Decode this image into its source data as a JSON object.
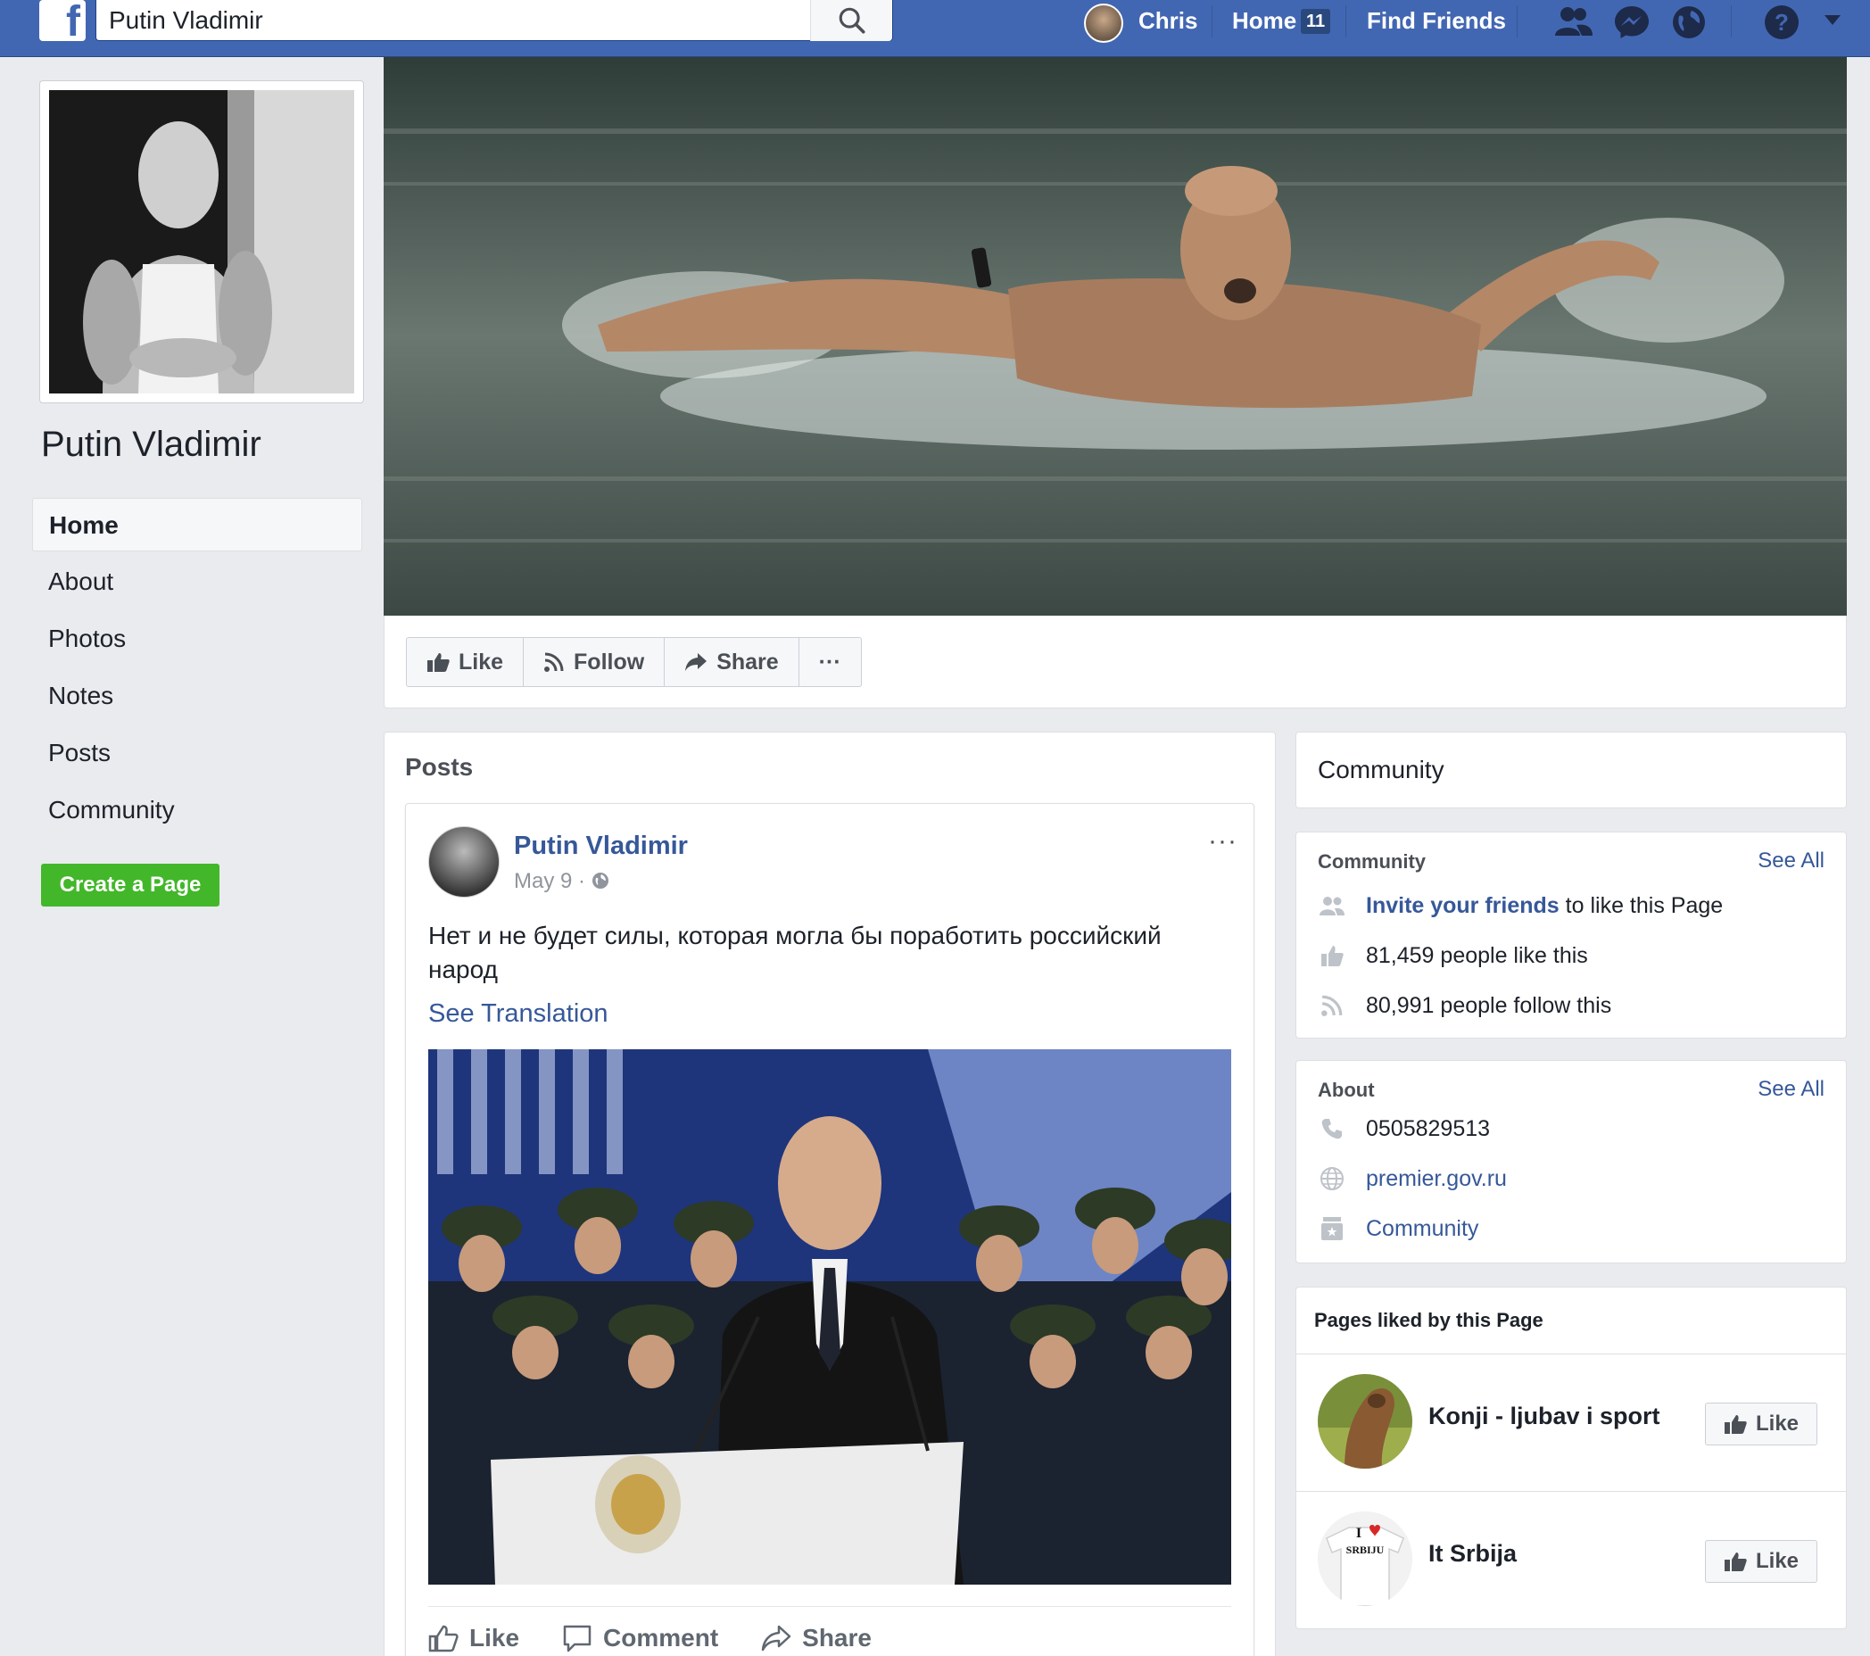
{
  "topbar": {
    "logo_letter": "f",
    "search_value": "Putin Vladimir",
    "user_name": "Chris",
    "home_label": "Home",
    "home_count": "11",
    "find_friends_label": "Find Friends",
    "icons": [
      "friend-requests-icon",
      "messenger-icon",
      "notifications-globe-icon",
      "help-icon",
      "account-menu-caret-icon"
    ]
  },
  "sidebar": {
    "page_name": "Putin Vladimir",
    "items": [
      {
        "label": "Home",
        "active": true
      },
      {
        "label": "About"
      },
      {
        "label": "Photos"
      },
      {
        "label": "Notes"
      },
      {
        "label": "Posts"
      },
      {
        "label": "Community"
      }
    ],
    "create_page_label": "Create a Page"
  },
  "actions": {
    "like": "Like",
    "follow": "Follow",
    "share": "Share",
    "more": "···"
  },
  "posts": {
    "section_title": "Posts",
    "post": {
      "author": "Putin Vladimir",
      "date": "May 9 ·",
      "text": "Нет и не будет силы, которая могла бы поработить российский народ",
      "see_translation": "See Translation",
      "menu": "···",
      "actions": {
        "like": "Like",
        "comment": "Comment",
        "share": "Share"
      }
    }
  },
  "community_header": {
    "title": "Community"
  },
  "community": {
    "title": "Community",
    "see_all": "See All",
    "invite_link": "Invite your friends",
    "invite_rest": " to like this Page",
    "likes": "81,459 people like this",
    "follows": "80,991 people follow this"
  },
  "about": {
    "title": "About",
    "see_all": "See All",
    "phone": "0505829513",
    "website": "premier.gov.ru",
    "category": "Community"
  },
  "liked_pages": {
    "title": "Pages liked by this Page",
    "pages": [
      {
        "name": "Konji - ljubav i sport",
        "like": "Like"
      },
      {
        "name": "It Srbija",
        "like": "Like",
        "thumb_text_1": "I",
        "thumb_text_2": "SRBIJU"
      }
    ]
  },
  "colors": {
    "topbar": "#4267b2",
    "link": "#365899",
    "create_button": "#42b72a",
    "background": "#e9ebee"
  }
}
